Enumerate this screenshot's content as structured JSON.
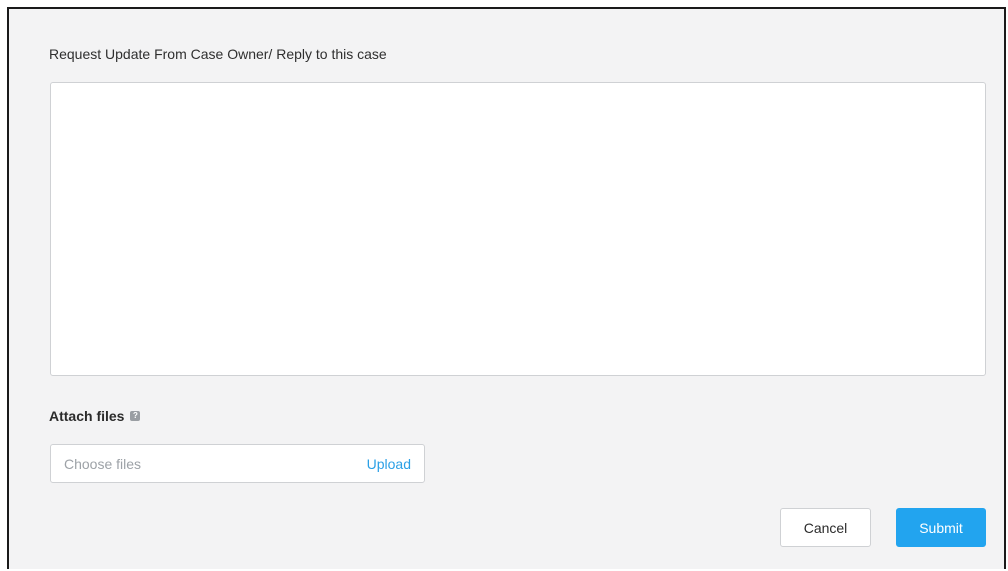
{
  "form": {
    "title": "Request Update From Case Owner/ Reply to this case",
    "reply_value": "",
    "attach_label": "Attach files",
    "help_icon": "help-icon",
    "file_placeholder": "Choose files",
    "upload_label": "Upload",
    "cancel_label": "Cancel",
    "submit_label": "Submit"
  },
  "colors": {
    "background": "#f3f3f4",
    "accent": "#22a4ef",
    "link": "#2ba0e6",
    "border": "#cfd1d4"
  }
}
